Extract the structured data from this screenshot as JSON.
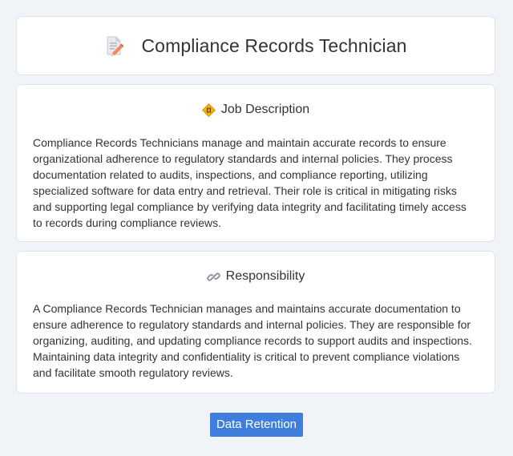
{
  "header": {
    "title": "Compliance Records Technician",
    "icon": "document-pencil-icon"
  },
  "sections": [
    {
      "icon": "diamond-badge-icon",
      "heading": "Job Description",
      "text": "Compliance Records Technicians manage and maintain accurate records to ensure organizational adherence to regulatory standards and internal policies. They process documentation related to audits, inspections, and compliance reporting, utilizing specialized software for data entry and retrieval. Their role is critical in mitigating risks and supporting legal compliance by verifying data integrity and facilitating timely access to records during compliance reviews."
    },
    {
      "icon": "link-icon",
      "heading": "Responsibility",
      "text": "A Compliance Records Technician manages and maintains accurate documentation to ensure adherence to regulatory standards and internal policies. They are responsible for organizing, auditing, and updating compliance records to support audits and inspections. Maintaining data integrity and confidentiality is critical to prevent compliance violations and facilitate smooth regulatory reviews."
    }
  ],
  "tags": [
    "Data Retention"
  ],
  "colors": {
    "background": "#f0f3f8",
    "card": "#ffffff",
    "accent": "#3f7fdb",
    "text": "#333333"
  }
}
